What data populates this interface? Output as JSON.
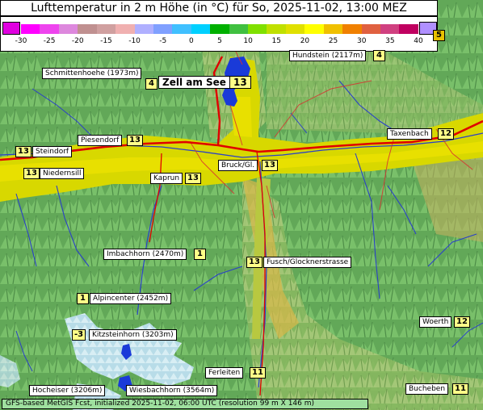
{
  "title": "Lufttemperatur in 2 m Höhe (in °C) für So, 2025-11-02, 13:00 MEZ",
  "legend": {
    "ticks": [
      "-30",
      "-25",
      "-20",
      "-15",
      "-10",
      "-5",
      "0",
      "5",
      "10",
      "15",
      "20",
      "25",
      "30",
      "35",
      "40"
    ],
    "colors": [
      "#ff00ff",
      "#ee44ee",
      "#dd88dd",
      "#c09090",
      "#d0a0a0",
      "#f0b0b0",
      "#b0b0ff",
      "#80a0ff",
      "#40c0ff",
      "#00d0ff",
      "#00b000",
      "#40c040",
      "#80e000",
      "#c0e000",
      "#e0e000",
      "#ffff00",
      "#f0c000",
      "#f08000",
      "#e06040",
      "#d04080",
      "#c00060"
    ],
    "low_color": "#e000e0",
    "high_color": "#b090ff"
  },
  "places": [
    {
      "name": "Hundstein (2117m)",
      "value": "4"
    },
    {
      "name": "Schmittenhoehe (1973m)",
      "value": "4"
    },
    {
      "name": "Zell am See",
      "value": "13"
    },
    {
      "name": "Piesendorf",
      "value": "13"
    },
    {
      "name": "Steindorf",
      "value": "13"
    },
    {
      "name": "Niedernsill",
      "value": "13"
    },
    {
      "name": "Kaprun",
      "value": "13"
    },
    {
      "name": "Bruck/Gl.",
      "value": "13"
    },
    {
      "name": "Taxenbach",
      "value": "12"
    },
    {
      "name": "Imbachhorn (2470m)",
      "value": "1"
    },
    {
      "name": "Fusch/Glocknerstrasse",
      "value": "13"
    },
    {
      "name": "Alpincenter (2452m)",
      "value": "1"
    },
    {
      "name": "Kitzsteinhorn (3203m)",
      "value": "-3"
    },
    {
      "name": "Woerth",
      "value": "12"
    },
    {
      "name": "Ferleiten",
      "value": "11"
    },
    {
      "name": "Hocheiser (3206m)",
      "value": ""
    },
    {
      "name": "Wiesbachhorn (3564m)",
      "value": ""
    },
    {
      "name": "Bucheben",
      "value": "11"
    }
  ],
  "edge_value": "5",
  "footer": "GFS-based MetGIS Fcst, initialized 2025-11-02, 06:00 UTC  (resolution 99 m X 146 m)"
}
